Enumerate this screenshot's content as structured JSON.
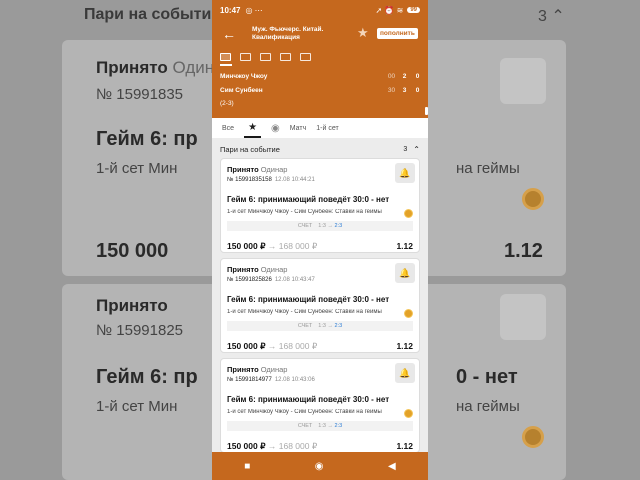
{
  "statusbar": {
    "time": "10:47",
    "dots": "◎ ⋯",
    "icons": "➚ ⏰ ≋",
    "battery": "99"
  },
  "header": {
    "title": "Муж. Фьючерс. Китай. Квалификация",
    "topup_label": "пополнить"
  },
  "match": {
    "player1": {
      "name": "Минчжоу Чжоу",
      "game": "00",
      "set": "2",
      "sets": "0"
    },
    "player2": {
      "name": "Сим Сунбеен",
      "game": "30",
      "set": "3",
      "sets": "0"
    },
    "set_score": "(2-3)"
  },
  "tabs": {
    "all": "Все",
    "match": "Матч",
    "set1": "1-й сет"
  },
  "section": {
    "title": "Пари на событие",
    "count": "3"
  },
  "bets": [
    {
      "status": "Принято",
      "type": "Одинар",
      "id": "№ 15991835158",
      "datetime": "12.08 10:44:21",
      "market": "Гейм 6: принимающий поведёт 30:0 - нет",
      "event": "1-й сет Минчжоу Чжоу - Сим Сунбеен: Ставки на геймы",
      "score_label": "СЧЕТ",
      "score_from": "1:3",
      "score_to": "2:3",
      "stake": "150 000 ₽",
      "win": "168 000 ₽",
      "coef": "1.12"
    },
    {
      "status": "Принято",
      "type": "Одинар",
      "id": "№ 15991825826",
      "datetime": "12.08 10:43:47",
      "market": "Гейм 6: принимающий поведёт 30:0 - нет",
      "event": "1-й сет Минчжоу Чжоу - Сим Сунбеен: Ставки на геймы",
      "score_label": "СЧЕТ",
      "score_from": "1:3",
      "score_to": "2:3",
      "stake": "150 000 ₽",
      "win": "168 000 ₽",
      "coef": "1.12"
    },
    {
      "status": "Принято",
      "type": "Одинар",
      "id": "№ 15991814977",
      "datetime": "12.08 10:43:06",
      "market": "Гейм 6: принимающий поведёт 30:0 - нет",
      "event": "1-й сет Минчжоу Чжоу - Сим Сунбеен: Ставки на геймы",
      "score_label": "СЧЕТ",
      "score_from": "1:3",
      "score_to": "2:3",
      "stake": "150 000 ₽",
      "win": "168 000 ₽",
      "coef": "1.12"
    }
  ],
  "background": {
    "title": "Пари на событие",
    "count": "3",
    "status": "Принято",
    "type": "Одинар",
    "id1": "№ 15991835",
    "market": "Гейм 6: пр",
    "market_right": "0 - нет",
    "event": "1-й сет Мин",
    "event_right": "на геймы",
    "stake": "150 000",
    "coef": "1.12",
    "id2": "№ 15991825",
    "market2": "Гейм 6: пр",
    "event2": "1-й сет Мин",
    "market3_right": "0 - нет",
    "event3_right": "на геймы"
  },
  "colors": {
    "brand": "#c5681e",
    "link": "#2a7bd4",
    "coin": "#e3a228"
  }
}
